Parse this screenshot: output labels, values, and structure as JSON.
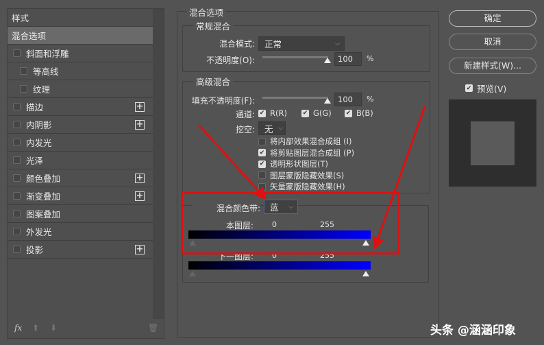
{
  "sidebar": {
    "title": "样式",
    "items": [
      {
        "label": "混合选项",
        "selected": true
      },
      {
        "label": "斜面和浮雕",
        "checkbox": true
      },
      {
        "label": "等高线",
        "checkbox": true,
        "indent": true
      },
      {
        "label": "纹理",
        "checkbox": true,
        "indent": true
      },
      {
        "label": "描边",
        "checkbox": true,
        "plus": true
      },
      {
        "label": "内阴影",
        "checkbox": true,
        "plus": true
      },
      {
        "label": "内发光",
        "checkbox": true
      },
      {
        "label": "光泽",
        "checkbox": true
      },
      {
        "label": "颜色叠加",
        "checkbox": true,
        "plus": true
      },
      {
        "label": "渐变叠加",
        "checkbox": true,
        "plus": true
      },
      {
        "label": "图案叠加",
        "checkbox": true
      },
      {
        "label": "外发光",
        "checkbox": true
      },
      {
        "label": "投影",
        "checkbox": true,
        "plus": true
      }
    ],
    "fx_label": "fx"
  },
  "main": {
    "title": "混合选项",
    "general": {
      "title": "常规混合",
      "mode_label": "混合模式:",
      "mode_value": "正常",
      "opacity_label": "不透明度(O):",
      "opacity_value": "100",
      "percent": "%",
      "opacity": 100
    },
    "advanced": {
      "title": "高级混合",
      "fill_label": "填充不透明度(F):",
      "fill_value": "100",
      "percent": "%",
      "channels_label": "通道:",
      "r": "R(R)",
      "g": "G(G)",
      "b": "B(B)",
      "knockout_label": "挖空:",
      "knockout_value": "无",
      "options": [
        {
          "label": "将内部效果混合成组 (I)",
          "checked": false
        },
        {
          "label": "将剪贴图层混合成组 (P)",
          "checked": true
        },
        {
          "label": "透明形状图层(T)",
          "checked": true
        },
        {
          "label": "图层蒙版隐藏效果(S)",
          "checked": false
        },
        {
          "label": "矢量蒙版隐藏效果(H)",
          "checked": false
        }
      ]
    },
    "blend_if": {
      "label": "混合颜色带:",
      "value": "蓝",
      "this_layer": "本图层:",
      "this_min": "0",
      "this_max": "255",
      "under_layer": "下一图层:",
      "under_min": "0",
      "under_max": "255"
    }
  },
  "buttons": {
    "ok": "确定",
    "cancel": "取消",
    "new_style": "新建样式(W)...",
    "preview": "预览(V)"
  },
  "watermark": "头条 @涵涵印象",
  "colors": {
    "annotation": "#e01010",
    "band": "#0000ff"
  }
}
